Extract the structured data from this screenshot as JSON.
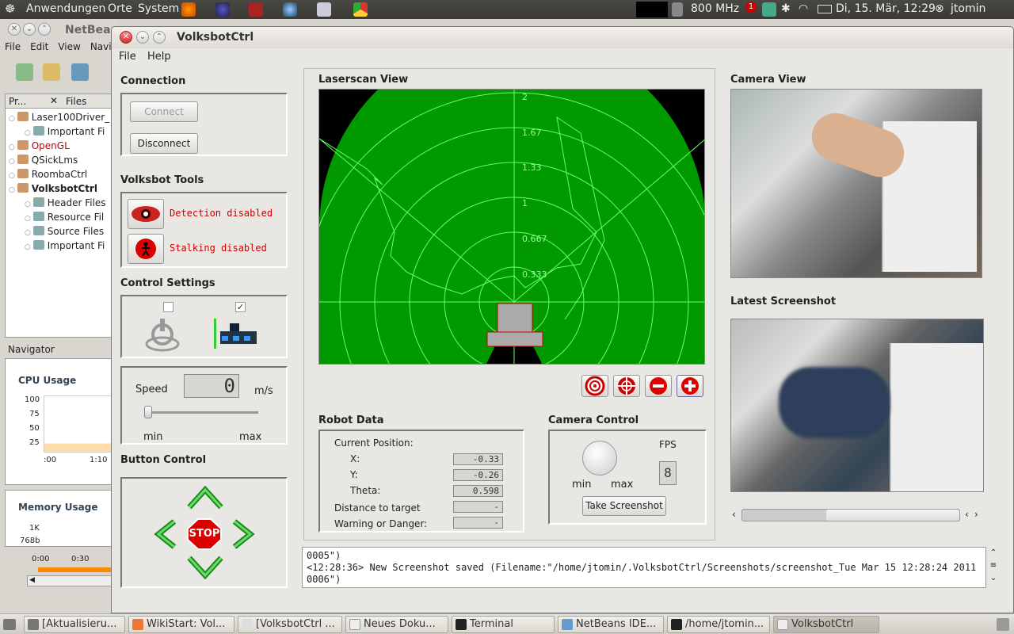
{
  "top_panel": {
    "menus": [
      "Anwendungen",
      "Orte",
      "System"
    ],
    "cpu_freq": "800 MHz",
    "clock": "Di, 15. Mär, 12:29",
    "user": "jtomin",
    "notification_count": "1"
  },
  "netbeans": {
    "title": "NetBea",
    "menus": [
      "File",
      "Edit",
      "View",
      "Navig"
    ],
    "tabs": [
      "Pr...",
      "Files"
    ],
    "tree": [
      {
        "label": "Laser100Driver_",
        "level": 0,
        "color": "#222"
      },
      {
        "label": "Important Fi",
        "level": 1,
        "color": "#222"
      },
      {
        "label": "OpenGL",
        "level": 0,
        "color": "#c00"
      },
      {
        "label": "QSickLms",
        "level": 0,
        "color": "#222"
      },
      {
        "label": "RoombaCtrl",
        "level": 0,
        "color": "#222"
      },
      {
        "label": "VolksbotCtrl",
        "level": 0,
        "color": "#222",
        "bold": true
      },
      {
        "label": "Header Files",
        "level": 1,
        "color": "#222"
      },
      {
        "label": "Resource Fil",
        "level": 1,
        "color": "#222"
      },
      {
        "label": "Source Files",
        "level": 1,
        "color": "#222"
      },
      {
        "label": "Important Fi",
        "level": 1,
        "color": "#222"
      }
    ],
    "navigator_label": "Navigator",
    "cpu_usage_label": "CPU Usage",
    "cpu_ticks": [
      "100",
      "75",
      "50",
      "25"
    ],
    "cpu_times": [
      ":00",
      "1:10"
    ],
    "memory_label": "Memory Usage",
    "memory_ticks": [
      "1K",
      "768b"
    ],
    "bottom_times": [
      "0:00",
      "0:30"
    ]
  },
  "window": {
    "title": "VolksbotCtrl",
    "menus": [
      "File",
      "Help"
    ]
  },
  "connection": {
    "title": "Connection",
    "connect_label": "Connect",
    "disconnect_label": "Disconnect"
  },
  "tools": {
    "title": "Volksbot Tools",
    "detection_status": "Detection disabled",
    "stalking_status": "Stalking disabled"
  },
  "control_settings": {
    "title": "Control Settings",
    "joystick_checked": false,
    "keyboard_checked": true
  },
  "speed": {
    "label": "Speed",
    "value": "0",
    "unit": "m/s",
    "min_label": "min",
    "max_label": "max",
    "slider_fraction": 0
  },
  "button_control": {
    "title": "Button Control",
    "stop_label": "STOP"
  },
  "laserscan": {
    "title": "Laserscan View",
    "ring_labels": [
      "2",
      "1.67",
      "1.33",
      "1",
      "0.667",
      "0.333"
    ]
  },
  "robot_data": {
    "title": "Robot Data",
    "current_position_label": "Current Position:",
    "x_label": "X:",
    "x_value": "-0.33",
    "y_label": "Y:",
    "y_value": "-0.26",
    "theta_label": "Theta:",
    "theta_value": "0.598",
    "distance_label": "Distance to target",
    "distance_value": "-",
    "warning_label": "Warning or Danger:",
    "warning_value": "-"
  },
  "camera_control": {
    "title": "Camera Control",
    "fps_label": "FPS",
    "fps_value": "8",
    "min_label": "min",
    "max_label": "max",
    "screenshot_label": "Take Screenshot"
  },
  "camera_view": {
    "title": "Camera View"
  },
  "latest_screenshot": {
    "title": "Latest Screenshot"
  },
  "log": {
    "lines": [
      "0005\")",
      "<12:28:36>  New Screenshot saved (Filename:\"/home/jtomin/.VolksbotCtrl/Screenshots/screenshot_Tue Mar 15 12:28:24 2011",
      "0006\")"
    ]
  },
  "taskbar": [
    "[Aktualisieru...",
    "WikiStart: Vol...",
    "[VolksbotCtrl ...",
    "Neues Doku...",
    "Terminal",
    "NetBeans IDE...",
    "/home/jtomin...",
    "VolksbotCtrl"
  ],
  "colors": {
    "laser_green": "#009900",
    "laser_line": "#66ff66",
    "alert_red": "#cc0000"
  }
}
